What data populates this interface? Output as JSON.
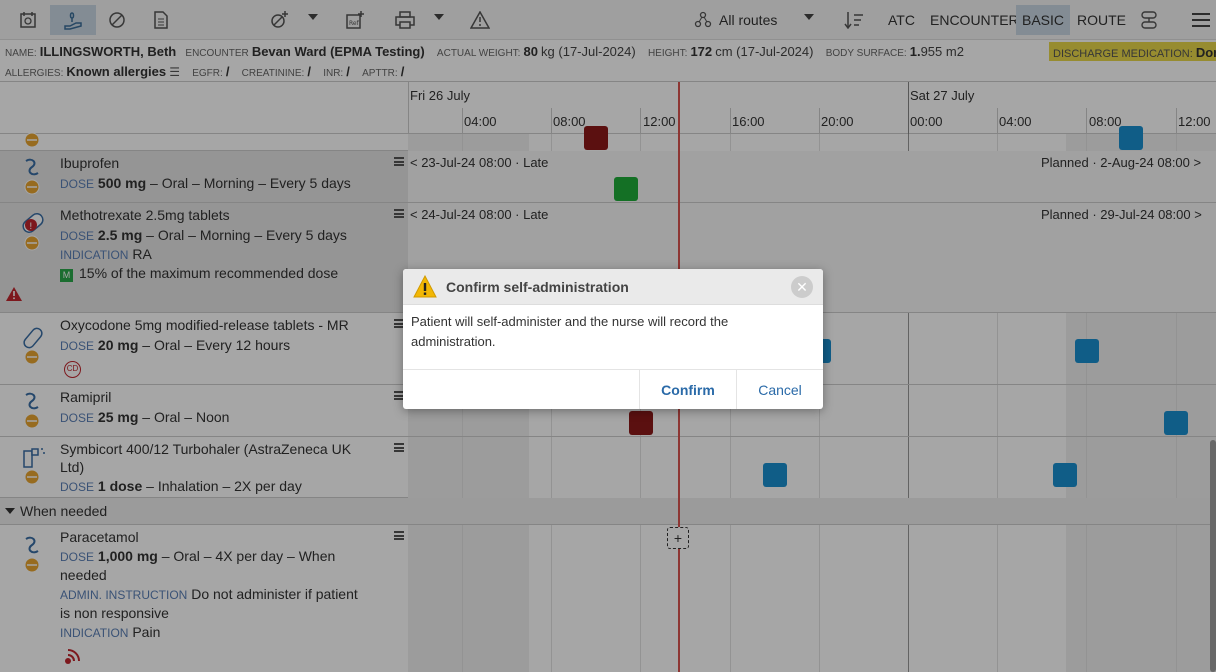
{
  "toolbar": {
    "routes_label": "All routes",
    "atc_label": "ATC",
    "encounter_label": "ENCOUNTER",
    "basic_label": "BASIC",
    "route_label": "ROUTE"
  },
  "patient": {
    "name_label": "NAME:",
    "name": "ILLINGSWORTH, Beth",
    "encounter_label": "ENCOUNTER",
    "encounter": "Bevan Ward (EPMA Testing)",
    "weight_label": "ACTUAL WEIGHT:",
    "weight": "80",
    "weight_unit": "kg (17-Jul-2024)",
    "height_label": "HEIGHT:",
    "height": "172",
    "height_unit": "cm (17-Jul-2024)",
    "bsa_label": "BODY SURFACE:",
    "bsa_whole": "1.",
    "bsa_frac": "955 m2",
    "discharge_label": "DISCHARGE MEDICATION:",
    "discharge_value": "Done",
    "allergies_label": "ALLERGIES:",
    "allergies": "Known allergies",
    "egfr_label": "EGFR:",
    "egfr": "/",
    "creatinine_label": "CREATININE:",
    "creatinine": "/",
    "inr_label": "INR:",
    "inr": "/",
    "apttr_label": "APTTR:",
    "apttr": "/"
  },
  "timeline": {
    "day1": "Fri 26 July",
    "day2": "Sat 27 July",
    "hours": [
      "04:00",
      "08:00",
      "12:00",
      "16:00",
      "20:00",
      "00:00",
      "04:00",
      "08:00",
      "12:00"
    ]
  },
  "meds": {
    "ibuprofen": {
      "name": "Ibuprofen",
      "dose_label": "DOSE",
      "dose": "500 mg",
      "rest": " – Oral – Morning – Every 5 days",
      "prev": "< 23-Jul-24 08:00 · Late",
      "next": "Planned · 2-Aug-24 08:00 >"
    },
    "methotrexate": {
      "name": "Methotrexate 2.5mg tablets",
      "dose_label": "DOSE",
      "dose": "2.5 mg",
      "rest": " – Oral – Morning – Every 5 days",
      "ind_label": "INDICATION",
      "ind": " RA",
      "maxdose": "15% of the maximum recommended dose",
      "prev": "< 24-Jul-24 08:00 · Late",
      "next": "Planned · 29-Jul-24 08:00 >"
    },
    "oxycodone": {
      "name": "Oxycodone 5mg modified-release tablets - MR",
      "dose_label": "DOSE",
      "dose": "20 mg",
      "rest": " – Oral – Every 12 hours",
      "badge": "CD"
    },
    "ramipril": {
      "name": "Ramipril",
      "dose_label": "DOSE",
      "dose": "25 mg",
      "rest": " – Oral – Noon"
    },
    "symbicort": {
      "name_line1": "Symbicort 400/12 Turbohaler (AstraZeneca UK",
      "name_line2": "Ltd)",
      "dose_label": "DOSE",
      "dose": "1 dose",
      "rest": " – Inhalation – 2X per day"
    },
    "section": "When needed",
    "paracetamol": {
      "name": "Paracetamol",
      "dose_label": "DOSE",
      "dose": "1,000 mg",
      "rest": " – Oral – 4X per day – When",
      "rest2": "needed",
      "admin_label": "ADMIN. INSTRUCTION",
      "admin": " Do not administer if patient",
      "admin2": "is non responsive",
      "ind_label": "INDICATION",
      "ind": " Pain"
    }
  },
  "plus": "+",
  "dialog": {
    "title": "Confirm self-administration",
    "body": "Patient will self-administer and the nurse will record the administration.",
    "confirm": "Confirm",
    "cancel": "Cancel",
    "close": "✕"
  },
  "colors": {
    "late_dose": "#8c1a1a",
    "given_dose": "#1fad3a",
    "planned_dose": "#1a8fd0",
    "now_line": "#d9534f",
    "discharge_bg": "#e8d84a"
  }
}
